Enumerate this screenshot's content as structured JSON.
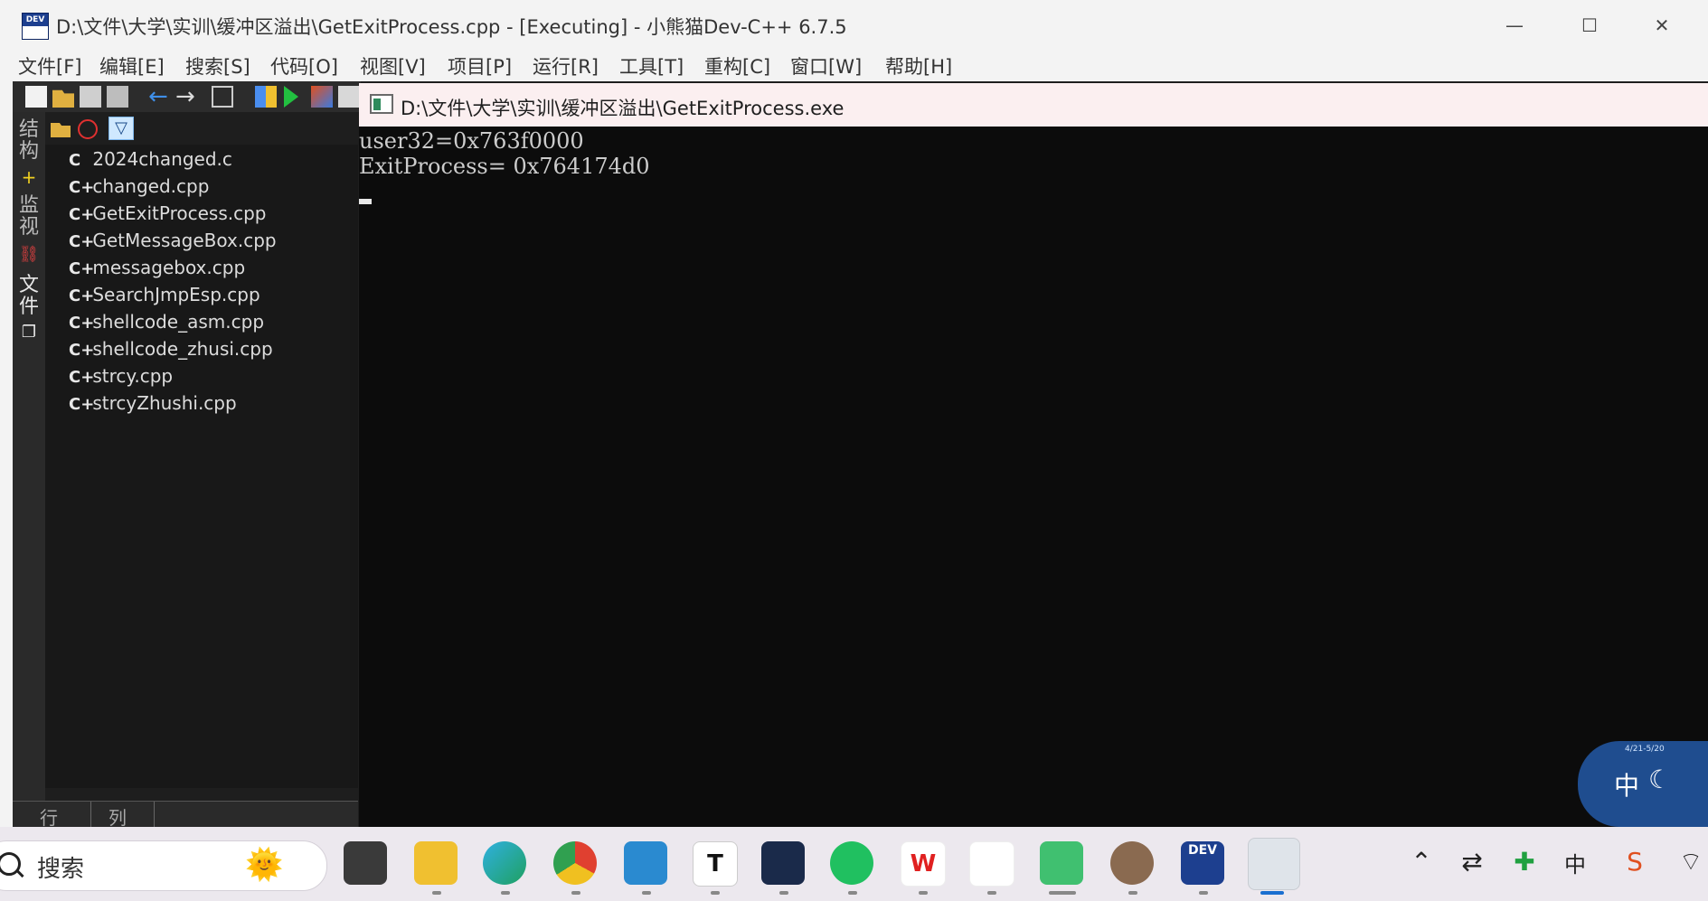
{
  "window": {
    "title": "D:\\文件\\大学\\实训\\缓冲区溢出\\GetExitProcess.cpp - [Executing] - 小熊猫Dev-C++ 6.7.5",
    "icon_label": "DEV",
    "controls": {
      "minimize": "—",
      "maximize": "☐",
      "close": "✕"
    }
  },
  "menu": [
    "文件[F]",
    "编辑[E]",
    "搜索[S]",
    "代码[O]",
    "视图[V]",
    "项目[P]",
    "运行[R]",
    "工具[T]",
    "重构[C]",
    "窗口[W]",
    "帮助[H]"
  ],
  "side_tabs": {
    "structure": "结构",
    "watch": "监视",
    "files": "文件"
  },
  "files": [
    {
      "name": "2024changed.c",
      "icon": "C"
    },
    {
      "name": "changed.cpp",
      "icon": "C+"
    },
    {
      "name": "GetExitProcess.cpp",
      "icon": "C+"
    },
    {
      "name": "GetMessageBox.cpp",
      "icon": "C+"
    },
    {
      "name": "messagebox.cpp",
      "icon": "C+"
    },
    {
      "name": "SearchJmpEsp.cpp",
      "icon": "C+"
    },
    {
      "name": "shellcode_asm.cpp",
      "icon": "C+"
    },
    {
      "name": "shellcode_zhusi.cpp",
      "icon": "C+"
    },
    {
      "name": "strcy.cpp",
      "icon": "C+"
    },
    {
      "name": "strcyZhushi.cpp",
      "icon": "C+"
    }
  ],
  "statusbar": {
    "row_label": "行",
    "col_label": "列"
  },
  "console": {
    "title": "D:\\文件\\大学\\实训\\缓冲区溢出\\GetExitProcess.exe",
    "lines": [
      "user32=0x763f0000",
      "ExitProcess= 0x764174d0"
    ]
  },
  "widget": {
    "ime_label": "中",
    "date_text": "4/21-5/20"
  },
  "taskbar": {
    "search_placeholder": "搜索",
    "apps": [
      "task-view",
      "file-explorer",
      "edge",
      "chrome",
      "notepad",
      "typora",
      "cat-app",
      "wechat",
      "wps",
      "baidu-netdisk",
      "music",
      "portrait-app",
      "devcpp",
      "console-window"
    ],
    "tray": {
      "ime": "中"
    }
  },
  "colors": {
    "accent": "#1d3f8f",
    "console_bg": "#0c0c0c",
    "ide_bg": "#1e1e1e"
  }
}
